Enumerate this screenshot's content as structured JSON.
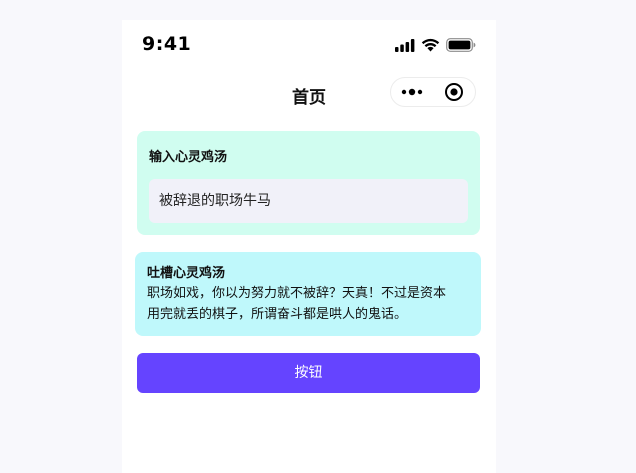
{
  "status_bar": {
    "time": "9:41",
    "icons": [
      "signal-icon",
      "wifi-icon",
      "battery-icon"
    ]
  },
  "nav": {
    "title": "首页",
    "capsule": [
      "more-icon",
      "close-target-icon"
    ]
  },
  "input_card": {
    "label": "输入心灵鸡汤",
    "value": "被辞退的职场牛马",
    "background": "#d0fdf0"
  },
  "output_card": {
    "title": "吐槽心灵鸡汤",
    "line1": "职场如戏，你以为努力就不被辞？天真！不过是资本",
    "line2": "用完就丢的棋子，所谓奋斗都是哄人的鬼话。",
    "background": "#bff8fb"
  },
  "action": {
    "button_label": "按钮",
    "color": "#6544ff"
  }
}
